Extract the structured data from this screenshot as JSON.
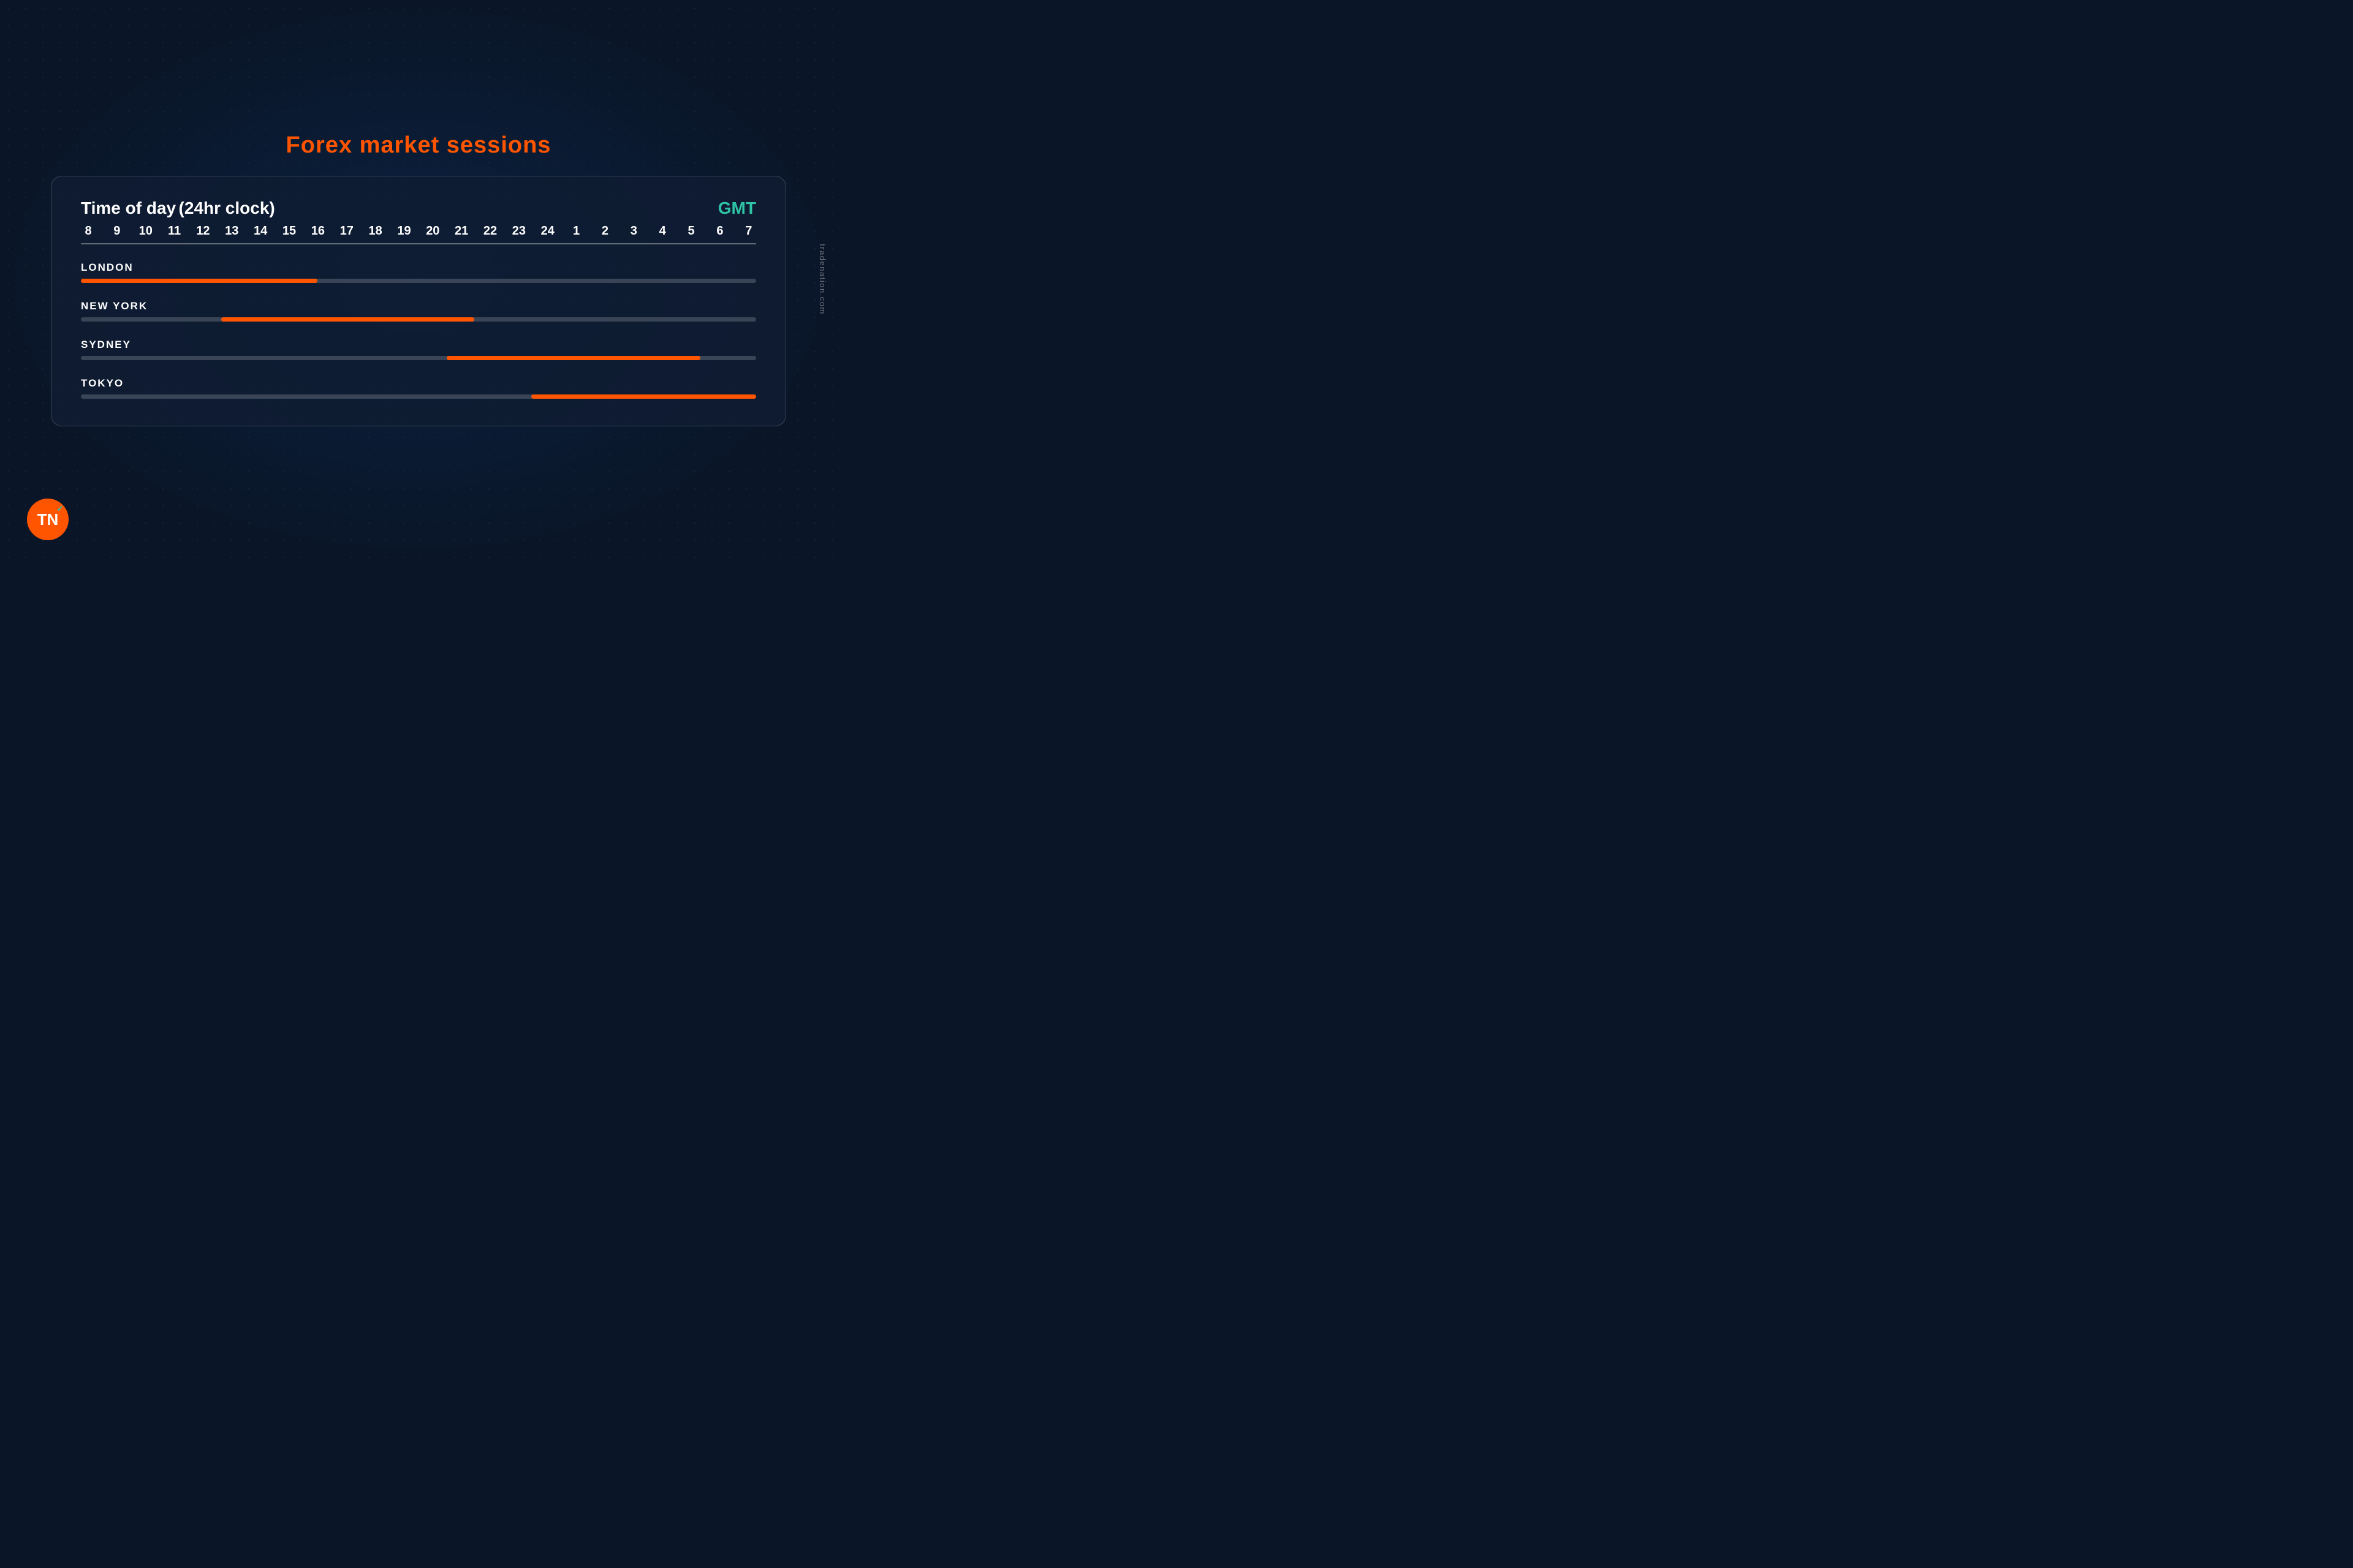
{
  "title": {
    "prefix": "Forex  ",
    "highlight": "market sessions"
  },
  "watermark": "tradenation.com",
  "card": {
    "time_label": "Time of day",
    "clock_note": "(24hr clock)",
    "gmt_label": "GMT",
    "hours": [
      "8",
      "9",
      "10",
      "11",
      "12",
      "13",
      "14",
      "15",
      "16",
      "17",
      "18",
      "19",
      "20",
      "21",
      "22",
      "23",
      "24",
      "1",
      "2",
      "3",
      "4",
      "5",
      "6",
      "7"
    ],
    "sessions": [
      {
        "name": "LONDON",
        "bar_class": "bar-london"
      },
      {
        "name": "NEW YORK",
        "bar_class": "bar-newyork"
      },
      {
        "name": "SYDNEY",
        "bar_class": "bar-sydney"
      },
      {
        "name": "TOKYO",
        "bar_class": "bar-tokyo"
      }
    ]
  },
  "logo": {
    "text": "TN"
  }
}
